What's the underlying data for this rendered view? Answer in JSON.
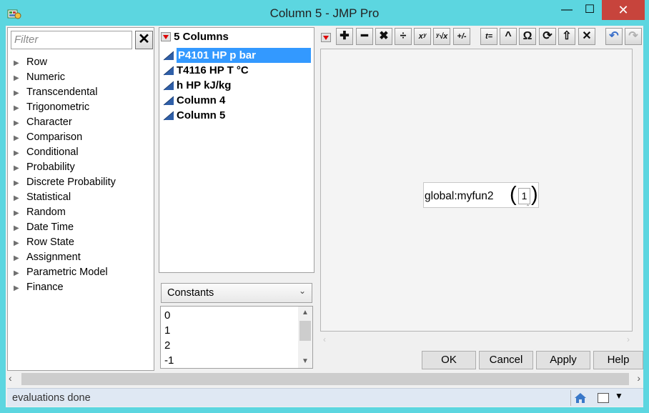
{
  "window": {
    "title": "Column 5 - JMP Pro",
    "minimize": "—",
    "maximize": "☐",
    "close": "✕"
  },
  "filter": {
    "placeholder": "Filter",
    "clear": "✕"
  },
  "categories": [
    "Row",
    "Numeric",
    "Transcendental",
    "Trigonometric",
    "Character",
    "Comparison",
    "Conditional",
    "Probability",
    "Discrete Probability",
    "Statistical",
    "Random",
    "Date Time",
    "Row State",
    "Assignment",
    "Parametric Model",
    "Finance"
  ],
  "columns": {
    "header": "5 Columns",
    "items": [
      {
        "label": "P4101 HP p bar",
        "selected": true
      },
      {
        "label": "T4116 HP T °C",
        "selected": false
      },
      {
        "label": " h HP kJ/kg",
        "selected": false
      },
      {
        "label": "Column 4",
        "selected": false
      },
      {
        "label": "Column 5",
        "selected": false
      }
    ]
  },
  "constants": {
    "selected": "Constants",
    "values": [
      "0",
      "1",
      "2",
      "-1"
    ]
  },
  "toolbar": {
    "items": [
      {
        "name": "add-icon",
        "glyph": "✚"
      },
      {
        "name": "subtract-icon",
        "glyph": "━"
      },
      {
        "name": "multiply-icon",
        "glyph": "✖"
      },
      {
        "name": "divide-icon",
        "glyph": "÷"
      },
      {
        "name": "power-icon",
        "glyph": "xʸ"
      },
      {
        "name": "root-icon",
        "glyph": "ʸ√x"
      },
      {
        "name": "sign-change-icon",
        "glyph": "+/-"
      },
      {
        "name": "assign-icon",
        "glyph": "t="
      },
      {
        "name": "peel-icon",
        "glyph": "^"
      },
      {
        "name": "unary-icon",
        "glyph": "Ω"
      },
      {
        "name": "swap-icon",
        "glyph": "⟳"
      },
      {
        "name": "local-variable-icon",
        "glyph": "⇧"
      },
      {
        "name": "delete-icon",
        "glyph": "✕"
      },
      {
        "name": "undo-icon",
        "glyph": "↶"
      },
      {
        "name": "redo-icon",
        "glyph": "↷"
      }
    ]
  },
  "formula": {
    "function": "global:myfun2",
    "argument": "1",
    "caret": "‸"
  },
  "buttons": {
    "ok": "OK",
    "cancel": "Cancel",
    "apply": "Apply",
    "help": "Help"
  },
  "status": {
    "text": "evaluations done"
  },
  "colors": {
    "titlebar": "#5cd6e0",
    "selection": "#3399ff",
    "close": "#c7443c",
    "status_bg": "#dfe8f3"
  }
}
